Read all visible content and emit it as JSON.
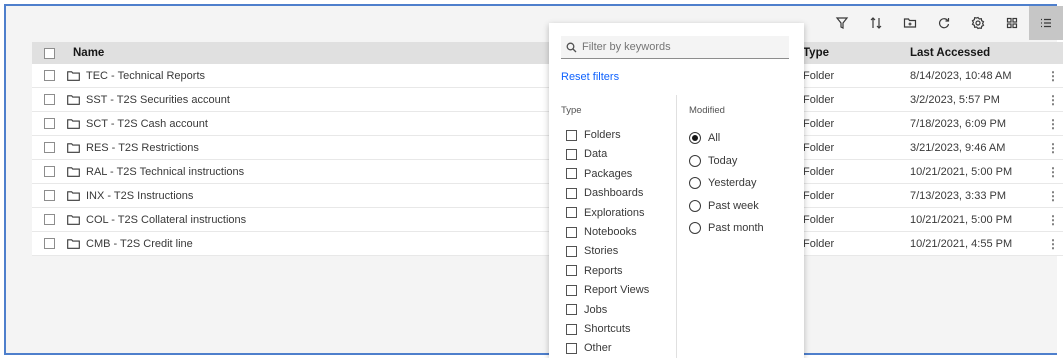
{
  "toolbar": {
    "buttons": [
      {
        "name": "filter-icon"
      },
      {
        "name": "sort-icon"
      },
      {
        "name": "new-folder-icon"
      },
      {
        "name": "refresh-icon"
      },
      {
        "name": "settings-icon"
      },
      {
        "name": "grid-view-icon"
      },
      {
        "name": "list-view-icon"
      }
    ]
  },
  "table": {
    "headers": {
      "name": "Name",
      "type": "Type",
      "last_accessed": "Last Accessed"
    },
    "rows": [
      {
        "name": "TEC - Technical Reports",
        "type": "Folder",
        "accessed": "8/14/2023, 10:48 AM"
      },
      {
        "name": "SST - T2S Securities account",
        "type": "Folder",
        "accessed": "3/2/2023, 5:57 PM"
      },
      {
        "name": "SCT - T2S Cash account",
        "type": "Folder",
        "accessed": "7/18/2023, 6:09 PM"
      },
      {
        "name": "RES - T2S Restrictions",
        "type": "Folder",
        "accessed": "3/21/2023, 9:46 AM"
      },
      {
        "name": "RAL - T2S Technical instructions",
        "type": "Folder",
        "accessed": "10/21/2021, 5:00 PM"
      },
      {
        "name": "INX - T2S Instructions",
        "type": "Folder",
        "accessed": "7/13/2023, 3:33 PM"
      },
      {
        "name": "COL - T2S Collateral instructions",
        "type": "Folder",
        "accessed": "10/21/2021, 5:00 PM"
      },
      {
        "name": "CMB - T2S Credit line",
        "type": "Folder",
        "accessed": "10/21/2021, 4:55 PM"
      }
    ],
    "overflow_glyph": "⋮"
  },
  "filter_panel": {
    "search_placeholder": "Filter by keywords",
    "reset_label": "Reset filters",
    "type_title": "Type",
    "modified_title": "Modified",
    "types": [
      "Folders",
      "Data",
      "Packages",
      "Dashboards",
      "Explorations",
      "Notebooks",
      "Stories",
      "Reports",
      "Report Views",
      "Jobs",
      "Shortcuts",
      "Other"
    ],
    "modified": [
      "All",
      "Today",
      "Yesterday",
      "Past week",
      "Past month"
    ],
    "modified_selected": "All"
  }
}
